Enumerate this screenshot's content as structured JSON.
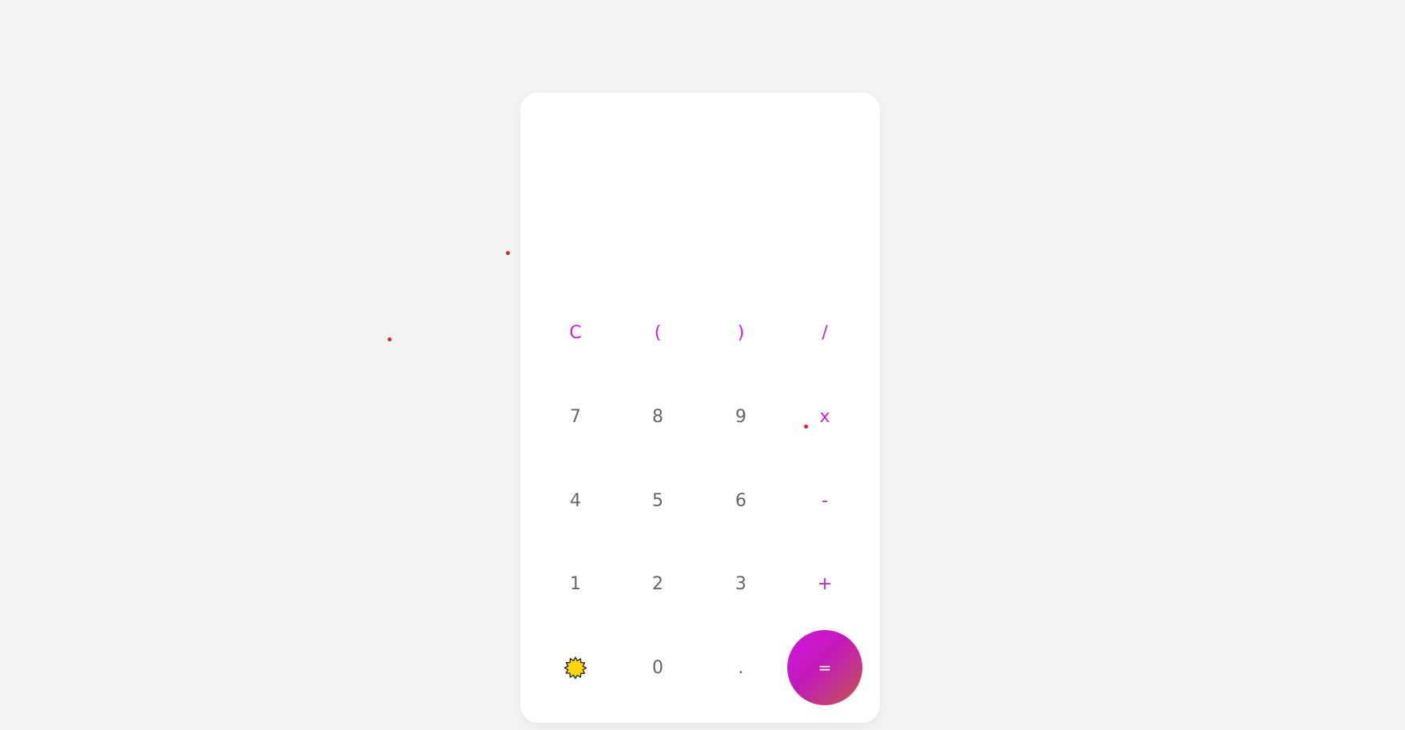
{
  "display": {
    "value": ""
  },
  "keys": {
    "clear": "C",
    "open_paren": "(",
    "close_paren": ")",
    "divide": "/",
    "seven": "7",
    "eight": "8",
    "nine": "9",
    "multiply": "x",
    "four": "4",
    "five": "5",
    "six": "6",
    "subtract": "-",
    "one": "1",
    "two": "2",
    "three": "3",
    "add": "+",
    "zero": "0",
    "decimal": ".",
    "equals": "="
  },
  "theme_toggle": {
    "icon": "sun-icon"
  },
  "colors": {
    "background": "#f4f4f4",
    "card": "#ffffff",
    "digit_text": "#666666",
    "operator_text": "#cc22dd",
    "equals_gradient_start": "#d414e6",
    "equals_gradient_end": "#c2574a",
    "sun_fill": "#ffd700",
    "dot_color": "#e0202a"
  }
}
